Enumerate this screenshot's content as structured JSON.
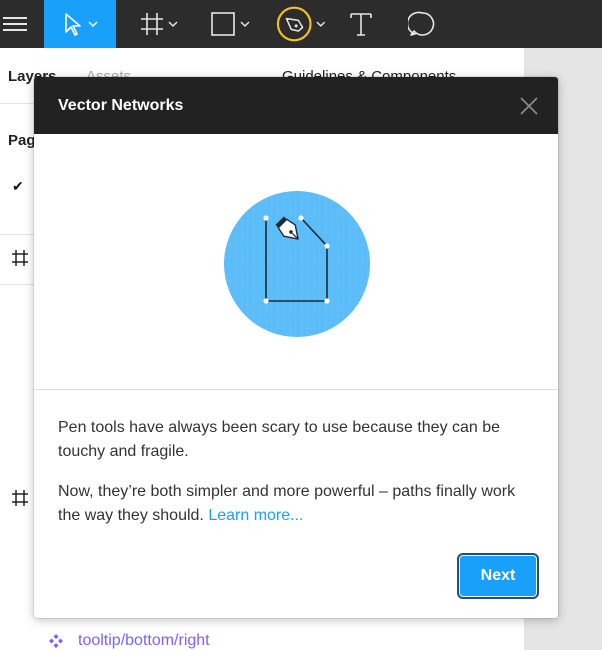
{
  "panel": {
    "tab_layers": "Layers",
    "tab_assets": "Assets",
    "tab_guidelines": "Guidelines & Components",
    "pages_label": "Pages",
    "component_label": "tooltip/bottom/right"
  },
  "modal": {
    "title": "Vector Networks",
    "paragraph1": "Pen tools have always been scary to use because they can be touchy and fragile.",
    "paragraph2": "Now, they’re both simpler and more powerful – paths finally work the way they should.",
    "learn_more": "Learn more...",
    "next_label": "Next"
  },
  "colors": {
    "toolbar_bg": "#2c2c2c",
    "accent": "#18a0fb",
    "highlight_ring": "#f5c518",
    "illustration_circle": "#5bbcf7",
    "component_text": "#7b61ff"
  },
  "icons": [
    "menu-icon",
    "move-icon",
    "frame-icon",
    "shape-icon",
    "pen-icon",
    "text-icon",
    "comment-icon",
    "close-icon",
    "checkmark-icon",
    "component-icon"
  ]
}
